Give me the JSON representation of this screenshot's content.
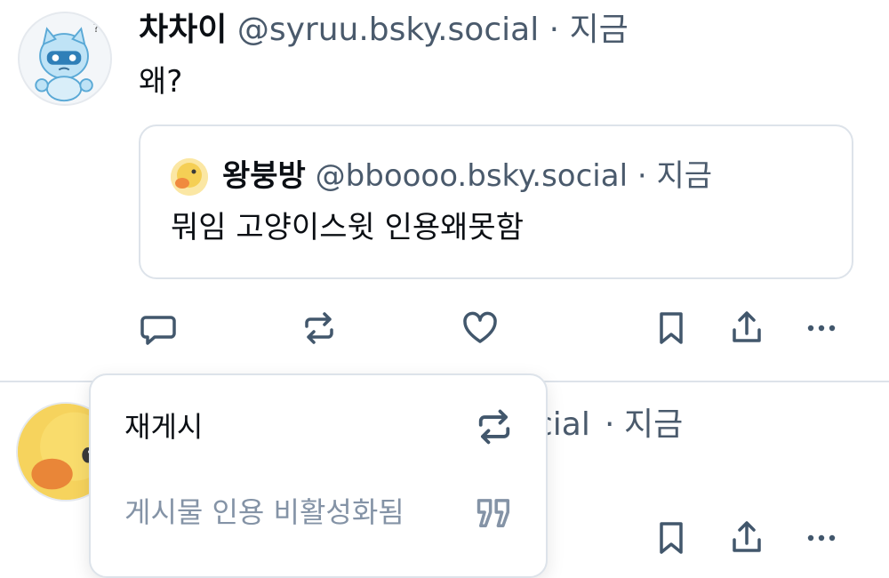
{
  "post1": {
    "author_name": "차차이",
    "author_handle": "@syruu.bsky.social",
    "separator": "·",
    "time": "지금",
    "text": "왜?",
    "quote": {
      "author_name": "왕붕방",
      "author_handle": "@bboooo.bsky.social",
      "separator": "·",
      "time": "지금",
      "text": "뭐임 고양이스윗 인용왜못함"
    },
    "actions": [
      "reply-icon",
      "repost-icon",
      "like-icon",
      "bookmark-icon",
      "share-icon",
      "more-icon"
    ]
  },
  "post2": {
    "author_handle_fragment": "cial",
    "separator": "·",
    "time": "지금"
  },
  "repost_menu": {
    "repost_label": "재게시",
    "quote_label": "게시물 인용 비활성화됨"
  },
  "colors": {
    "text": "#0b0f14",
    "muted": "#4a5a6c",
    "icon": "#42576c",
    "disabled": "#8493a6",
    "border": "#dde3ea"
  }
}
